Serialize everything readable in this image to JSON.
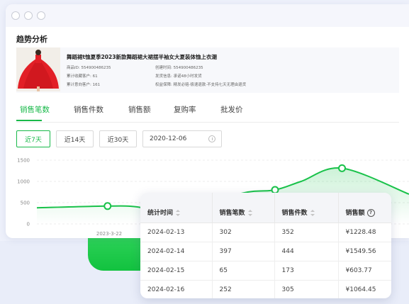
{
  "section_title": "趋势分析",
  "product": {
    "name": "舞蹈裙t恤夏季2023新款舞蹈裙大裙摆半袖女大夏装体恤上衣潮",
    "meta_left": [
      {
        "label": "商品ID:",
        "value": "554900486235"
      },
      {
        "label": "累计收藏客户:",
        "value": "61"
      },
      {
        "label": "累计意向客户:",
        "value": "161"
      }
    ],
    "meta_right": [
      {
        "label": "创建时间:",
        "value": "554900486235"
      },
      {
        "label": "发货信息:",
        "value": "承诺48小时发货"
      },
      {
        "label": "权益保障:",
        "value": "精发必赔·极速退款·不支持七天无理由退货"
      }
    ]
  },
  "tabs": [
    "销售笔数",
    "销售件数",
    "销售额",
    "复购率",
    "批发价"
  ],
  "active_tab": "销售笔数",
  "range_buttons": [
    "近7天",
    "近14天",
    "近30天"
  ],
  "date_value": "2020-12-06",
  "chart_data": {
    "type": "line",
    "y_ticks": [
      "1500",
      "1000",
      "500",
      "0"
    ],
    "ylim": [
      0,
      1500
    ],
    "x_ticks": [
      "2023-3-22"
    ],
    "series": [
      {
        "color": "#19c24a"
      }
    ],
    "points": [
      {
        "x": 0.0,
        "y": 380
      },
      {
        "x": 0.19,
        "y": 420
      },
      {
        "x": 0.27,
        "y": 400
      },
      {
        "x": 0.37,
        "y": 250
      },
      {
        "x": 0.55,
        "y": 720
      },
      {
        "x": 0.64,
        "y": 800
      },
      {
        "x": 0.71,
        "y": 1000
      },
      {
        "x": 0.82,
        "y": 1310
      },
      {
        "x": 1.0,
        "y": 700
      }
    ],
    "marked_points": [
      1,
      5,
      7
    ]
  },
  "table": {
    "headers": [
      "统计时间",
      "销售笔数",
      "销售件数",
      "销售额"
    ],
    "rows": [
      [
        "2024-02-13",
        "302",
        "352",
        "¥1228.48"
      ],
      [
        "2024-02-14",
        "397",
        "444",
        "¥1549.56"
      ],
      [
        "2024-02-15",
        "65",
        "173",
        "¥603.77"
      ],
      [
        "2024-02-16",
        "252",
        "305",
        "¥1064.45"
      ]
    ]
  }
}
